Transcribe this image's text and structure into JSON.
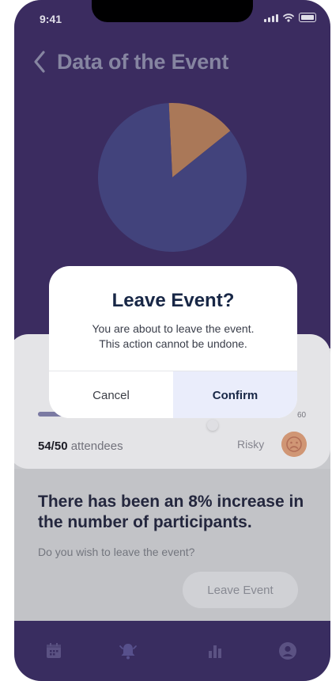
{
  "status_bar": {
    "time": "9:41"
  },
  "header": {
    "title": "Data of the Event"
  },
  "chart_data": {
    "type": "pie",
    "slices": [
      {
        "value": 15,
        "color": "#b07c5a"
      },
      {
        "value": 85,
        "color": "#45467f"
      }
    ]
  },
  "card": {
    "progress_fraction": 0.2,
    "scale_max": "60",
    "attendees_count": "54/50",
    "attendees_suffix": " attendees",
    "risk_label": "Risky"
  },
  "insight": {
    "headline": "There has been an 8% increase in the number of participants.",
    "question": "Do you wish to leave the event?",
    "leave_button": "Leave Event"
  },
  "nav": {
    "items": [
      "calendar-icon",
      "bell-icon",
      "bar-chart-icon",
      "profile-icon"
    ]
  },
  "dialog": {
    "title": "Leave Event?",
    "line1": "You are about to leave the event.",
    "line2": "This action cannot be undone.",
    "cancel": "Cancel",
    "confirm": "Confirm"
  },
  "colors": {
    "header_bg": "#3d2e63",
    "nav_bg": "#3b2f63",
    "accent": "#182746"
  }
}
